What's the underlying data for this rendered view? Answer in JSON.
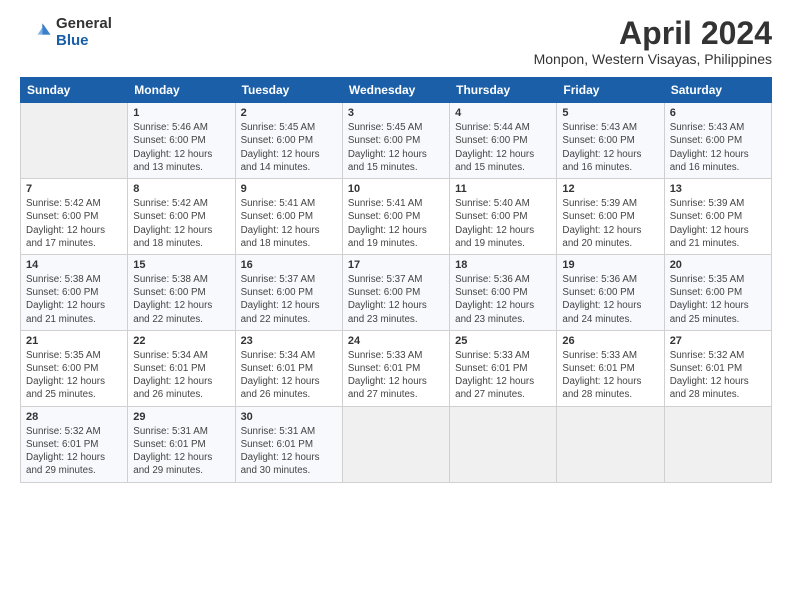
{
  "header": {
    "logo_general": "General",
    "logo_blue": "Blue",
    "title": "April 2024",
    "subtitle": "Monpon, Western Visayas, Philippines"
  },
  "calendar": {
    "weekdays": [
      "Sunday",
      "Monday",
      "Tuesday",
      "Wednesday",
      "Thursday",
      "Friday",
      "Saturday"
    ],
    "weeks": [
      [
        {
          "day": "",
          "info": ""
        },
        {
          "day": "1",
          "info": "Sunrise: 5:46 AM\nSunset: 6:00 PM\nDaylight: 12 hours\nand 13 minutes."
        },
        {
          "day": "2",
          "info": "Sunrise: 5:45 AM\nSunset: 6:00 PM\nDaylight: 12 hours\nand 14 minutes."
        },
        {
          "day": "3",
          "info": "Sunrise: 5:45 AM\nSunset: 6:00 PM\nDaylight: 12 hours\nand 15 minutes."
        },
        {
          "day": "4",
          "info": "Sunrise: 5:44 AM\nSunset: 6:00 PM\nDaylight: 12 hours\nand 15 minutes."
        },
        {
          "day": "5",
          "info": "Sunrise: 5:43 AM\nSunset: 6:00 PM\nDaylight: 12 hours\nand 16 minutes."
        },
        {
          "day": "6",
          "info": "Sunrise: 5:43 AM\nSunset: 6:00 PM\nDaylight: 12 hours\nand 16 minutes."
        }
      ],
      [
        {
          "day": "7",
          "info": "Sunrise: 5:42 AM\nSunset: 6:00 PM\nDaylight: 12 hours\nand 17 minutes."
        },
        {
          "day": "8",
          "info": "Sunrise: 5:42 AM\nSunset: 6:00 PM\nDaylight: 12 hours\nand 18 minutes."
        },
        {
          "day": "9",
          "info": "Sunrise: 5:41 AM\nSunset: 6:00 PM\nDaylight: 12 hours\nand 18 minutes."
        },
        {
          "day": "10",
          "info": "Sunrise: 5:41 AM\nSunset: 6:00 PM\nDaylight: 12 hours\nand 19 minutes."
        },
        {
          "day": "11",
          "info": "Sunrise: 5:40 AM\nSunset: 6:00 PM\nDaylight: 12 hours\nand 19 minutes."
        },
        {
          "day": "12",
          "info": "Sunrise: 5:39 AM\nSunset: 6:00 PM\nDaylight: 12 hours\nand 20 minutes."
        },
        {
          "day": "13",
          "info": "Sunrise: 5:39 AM\nSunset: 6:00 PM\nDaylight: 12 hours\nand 21 minutes."
        }
      ],
      [
        {
          "day": "14",
          "info": "Sunrise: 5:38 AM\nSunset: 6:00 PM\nDaylight: 12 hours\nand 21 minutes."
        },
        {
          "day": "15",
          "info": "Sunrise: 5:38 AM\nSunset: 6:00 PM\nDaylight: 12 hours\nand 22 minutes."
        },
        {
          "day": "16",
          "info": "Sunrise: 5:37 AM\nSunset: 6:00 PM\nDaylight: 12 hours\nand 22 minutes."
        },
        {
          "day": "17",
          "info": "Sunrise: 5:37 AM\nSunset: 6:00 PM\nDaylight: 12 hours\nand 23 minutes."
        },
        {
          "day": "18",
          "info": "Sunrise: 5:36 AM\nSunset: 6:00 PM\nDaylight: 12 hours\nand 23 minutes."
        },
        {
          "day": "19",
          "info": "Sunrise: 5:36 AM\nSunset: 6:00 PM\nDaylight: 12 hours\nand 24 minutes."
        },
        {
          "day": "20",
          "info": "Sunrise: 5:35 AM\nSunset: 6:00 PM\nDaylight: 12 hours\nand 25 minutes."
        }
      ],
      [
        {
          "day": "21",
          "info": "Sunrise: 5:35 AM\nSunset: 6:00 PM\nDaylight: 12 hours\nand 25 minutes."
        },
        {
          "day": "22",
          "info": "Sunrise: 5:34 AM\nSunset: 6:01 PM\nDaylight: 12 hours\nand 26 minutes."
        },
        {
          "day": "23",
          "info": "Sunrise: 5:34 AM\nSunset: 6:01 PM\nDaylight: 12 hours\nand 26 minutes."
        },
        {
          "day": "24",
          "info": "Sunrise: 5:33 AM\nSunset: 6:01 PM\nDaylight: 12 hours\nand 27 minutes."
        },
        {
          "day": "25",
          "info": "Sunrise: 5:33 AM\nSunset: 6:01 PM\nDaylight: 12 hours\nand 27 minutes."
        },
        {
          "day": "26",
          "info": "Sunrise: 5:33 AM\nSunset: 6:01 PM\nDaylight: 12 hours\nand 28 minutes."
        },
        {
          "day": "27",
          "info": "Sunrise: 5:32 AM\nSunset: 6:01 PM\nDaylight: 12 hours\nand 28 minutes."
        }
      ],
      [
        {
          "day": "28",
          "info": "Sunrise: 5:32 AM\nSunset: 6:01 PM\nDaylight: 12 hours\nand 29 minutes."
        },
        {
          "day": "29",
          "info": "Sunrise: 5:31 AM\nSunset: 6:01 PM\nDaylight: 12 hours\nand 29 minutes."
        },
        {
          "day": "30",
          "info": "Sunrise: 5:31 AM\nSunset: 6:01 PM\nDaylight: 12 hours\nand 30 minutes."
        },
        {
          "day": "",
          "info": ""
        },
        {
          "day": "",
          "info": ""
        },
        {
          "day": "",
          "info": ""
        },
        {
          "day": "",
          "info": ""
        }
      ]
    ]
  }
}
